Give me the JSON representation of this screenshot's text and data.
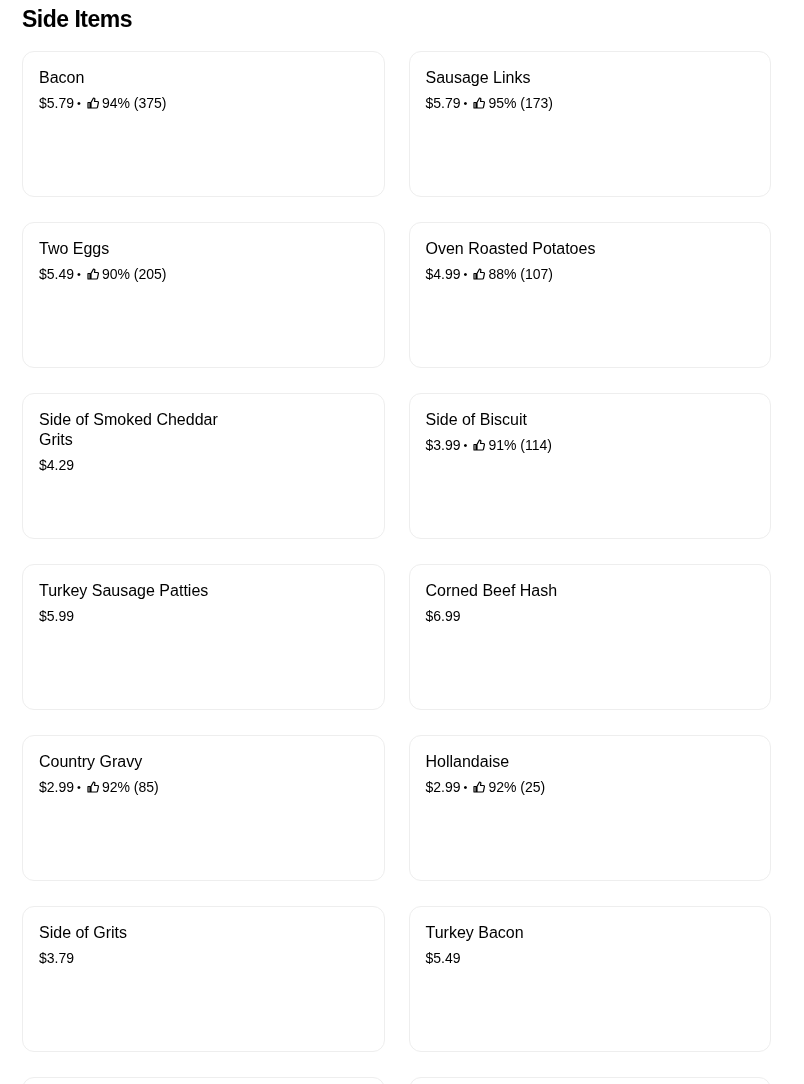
{
  "section_title": "Side Items",
  "items": [
    {
      "name": "Bacon",
      "price": "$5.79",
      "separator": "•",
      "rating": "94% (375)"
    },
    {
      "name": "Sausage Links",
      "price": "$5.79",
      "separator": "•",
      "rating": "95% (173)"
    },
    {
      "name": "Two Eggs",
      "price": "$5.49",
      "separator": "•",
      "rating": "90% (205)"
    },
    {
      "name": "Oven Roasted Potatoes",
      "price": "$4.99",
      "separator": "•",
      "rating": "88% (107)"
    },
    {
      "name": "Side of Smoked Cheddar Grits",
      "price": "$4.29"
    },
    {
      "name": "Side of Biscuit",
      "price": "$3.99",
      "separator": "•",
      "rating": "91% (114)"
    },
    {
      "name": "Turkey Sausage Patties",
      "price": "$5.99"
    },
    {
      "name": "Corned Beef Hash",
      "price": "$6.99"
    },
    {
      "name": "Country Gravy",
      "price": "$2.99",
      "separator": "•",
      "rating": "92% (85)"
    },
    {
      "name": "Hollandaise",
      "price": "$2.99",
      "separator": "•",
      "rating": "92% (25)"
    },
    {
      "name": "Side of Grits",
      "price": "$3.79"
    },
    {
      "name": "Turkey Bacon",
      "price": "$5.49"
    }
  ]
}
